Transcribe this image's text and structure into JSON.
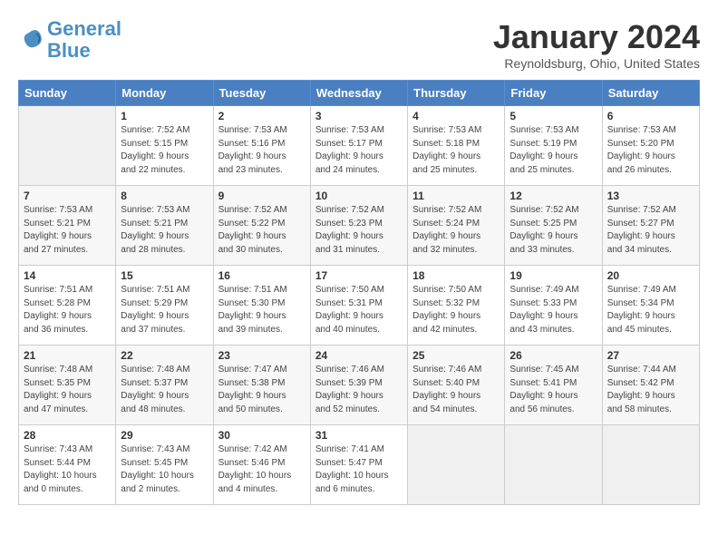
{
  "header": {
    "logo_line1": "General",
    "logo_line2": "Blue",
    "month": "January 2024",
    "location": "Reynoldsburg, Ohio, United States"
  },
  "weekdays": [
    "Sunday",
    "Monday",
    "Tuesday",
    "Wednesday",
    "Thursday",
    "Friday",
    "Saturday"
  ],
  "weeks": [
    [
      {
        "day": "",
        "info": ""
      },
      {
        "day": "1",
        "info": "Sunrise: 7:52 AM\nSunset: 5:15 PM\nDaylight: 9 hours\nand 22 minutes."
      },
      {
        "day": "2",
        "info": "Sunrise: 7:53 AM\nSunset: 5:16 PM\nDaylight: 9 hours\nand 23 minutes."
      },
      {
        "day": "3",
        "info": "Sunrise: 7:53 AM\nSunset: 5:17 PM\nDaylight: 9 hours\nand 24 minutes."
      },
      {
        "day": "4",
        "info": "Sunrise: 7:53 AM\nSunset: 5:18 PM\nDaylight: 9 hours\nand 25 minutes."
      },
      {
        "day": "5",
        "info": "Sunrise: 7:53 AM\nSunset: 5:19 PM\nDaylight: 9 hours\nand 25 minutes."
      },
      {
        "day": "6",
        "info": "Sunrise: 7:53 AM\nSunset: 5:20 PM\nDaylight: 9 hours\nand 26 minutes."
      }
    ],
    [
      {
        "day": "7",
        "info": "Sunrise: 7:53 AM\nSunset: 5:21 PM\nDaylight: 9 hours\nand 27 minutes."
      },
      {
        "day": "8",
        "info": "Sunrise: 7:53 AM\nSunset: 5:21 PM\nDaylight: 9 hours\nand 28 minutes."
      },
      {
        "day": "9",
        "info": "Sunrise: 7:52 AM\nSunset: 5:22 PM\nDaylight: 9 hours\nand 30 minutes."
      },
      {
        "day": "10",
        "info": "Sunrise: 7:52 AM\nSunset: 5:23 PM\nDaylight: 9 hours\nand 31 minutes."
      },
      {
        "day": "11",
        "info": "Sunrise: 7:52 AM\nSunset: 5:24 PM\nDaylight: 9 hours\nand 32 minutes."
      },
      {
        "day": "12",
        "info": "Sunrise: 7:52 AM\nSunset: 5:25 PM\nDaylight: 9 hours\nand 33 minutes."
      },
      {
        "day": "13",
        "info": "Sunrise: 7:52 AM\nSunset: 5:27 PM\nDaylight: 9 hours\nand 34 minutes."
      }
    ],
    [
      {
        "day": "14",
        "info": "Sunrise: 7:51 AM\nSunset: 5:28 PM\nDaylight: 9 hours\nand 36 minutes."
      },
      {
        "day": "15",
        "info": "Sunrise: 7:51 AM\nSunset: 5:29 PM\nDaylight: 9 hours\nand 37 minutes."
      },
      {
        "day": "16",
        "info": "Sunrise: 7:51 AM\nSunset: 5:30 PM\nDaylight: 9 hours\nand 39 minutes."
      },
      {
        "day": "17",
        "info": "Sunrise: 7:50 AM\nSunset: 5:31 PM\nDaylight: 9 hours\nand 40 minutes."
      },
      {
        "day": "18",
        "info": "Sunrise: 7:50 AM\nSunset: 5:32 PM\nDaylight: 9 hours\nand 42 minutes."
      },
      {
        "day": "19",
        "info": "Sunrise: 7:49 AM\nSunset: 5:33 PM\nDaylight: 9 hours\nand 43 minutes."
      },
      {
        "day": "20",
        "info": "Sunrise: 7:49 AM\nSunset: 5:34 PM\nDaylight: 9 hours\nand 45 minutes."
      }
    ],
    [
      {
        "day": "21",
        "info": "Sunrise: 7:48 AM\nSunset: 5:35 PM\nDaylight: 9 hours\nand 47 minutes."
      },
      {
        "day": "22",
        "info": "Sunrise: 7:48 AM\nSunset: 5:37 PM\nDaylight: 9 hours\nand 48 minutes."
      },
      {
        "day": "23",
        "info": "Sunrise: 7:47 AM\nSunset: 5:38 PM\nDaylight: 9 hours\nand 50 minutes."
      },
      {
        "day": "24",
        "info": "Sunrise: 7:46 AM\nSunset: 5:39 PM\nDaylight: 9 hours\nand 52 minutes."
      },
      {
        "day": "25",
        "info": "Sunrise: 7:46 AM\nSunset: 5:40 PM\nDaylight: 9 hours\nand 54 minutes."
      },
      {
        "day": "26",
        "info": "Sunrise: 7:45 AM\nSunset: 5:41 PM\nDaylight: 9 hours\nand 56 minutes."
      },
      {
        "day": "27",
        "info": "Sunrise: 7:44 AM\nSunset: 5:42 PM\nDaylight: 9 hours\nand 58 minutes."
      }
    ],
    [
      {
        "day": "28",
        "info": "Sunrise: 7:43 AM\nSunset: 5:44 PM\nDaylight: 10 hours\nand 0 minutes."
      },
      {
        "day": "29",
        "info": "Sunrise: 7:43 AM\nSunset: 5:45 PM\nDaylight: 10 hours\nand 2 minutes."
      },
      {
        "day": "30",
        "info": "Sunrise: 7:42 AM\nSunset: 5:46 PM\nDaylight: 10 hours\nand 4 minutes."
      },
      {
        "day": "31",
        "info": "Sunrise: 7:41 AM\nSunset: 5:47 PM\nDaylight: 10 hours\nand 6 minutes."
      },
      {
        "day": "",
        "info": ""
      },
      {
        "day": "",
        "info": ""
      },
      {
        "day": "",
        "info": ""
      }
    ]
  ]
}
